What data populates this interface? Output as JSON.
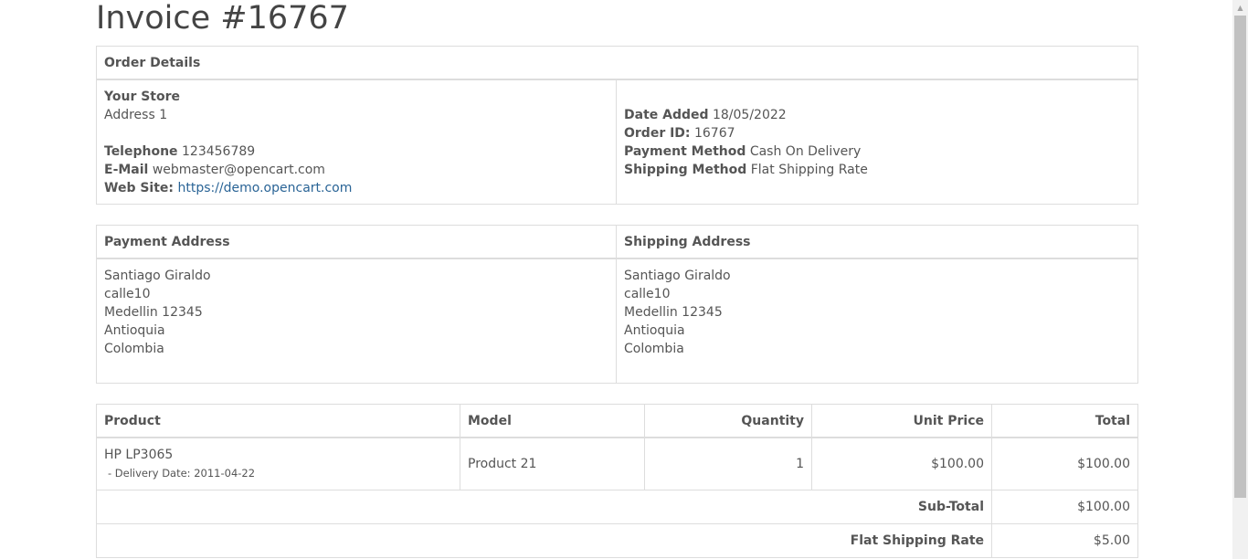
{
  "title": "Invoice #16767",
  "order_details": {
    "heading": "Order Details",
    "store_name": "Your Store",
    "store_address": "Address 1",
    "telephone_label": "Telephone",
    "telephone": "123456789",
    "email_label": "E-Mail",
    "email": "webmaster@opencart.com",
    "website_label": "Web Site:",
    "website": "https://demo.opencart.com",
    "date_added_label": "Date Added",
    "date_added": "18/05/2022",
    "order_id_label": "Order ID:",
    "order_id": "16767",
    "payment_method_label": "Payment Method",
    "payment_method": "Cash On Delivery",
    "shipping_method_label": "Shipping Method",
    "shipping_method": "Flat Shipping Rate"
  },
  "addresses": {
    "payment_heading": "Payment Address",
    "shipping_heading": "Shipping Address",
    "payment": [
      "Santiago Giraldo",
      "calle10",
      "Medellin 12345",
      "Antioquia",
      "Colombia"
    ],
    "shipping": [
      "Santiago Giraldo",
      "calle10",
      "Medellin 12345",
      "Antioquia",
      "Colombia"
    ]
  },
  "products": {
    "headers": {
      "product": "Product",
      "model": "Model",
      "quantity": "Quantity",
      "unit_price": "Unit Price",
      "total": "Total"
    },
    "rows": [
      {
        "name": "HP LP3065",
        "option": " - Delivery Date: 2011-04-22",
        "model": "Product 21",
        "quantity": "1",
        "unit_price": "$100.00",
        "total": "$100.00"
      }
    ],
    "totals": [
      {
        "label": "Sub-Total",
        "value": "$100.00"
      },
      {
        "label": "Flat Shipping Rate",
        "value": "$5.00"
      }
    ]
  },
  "icons": {
    "scroll_up": "triangle-up",
    "scroll_down": "triangle-down"
  }
}
